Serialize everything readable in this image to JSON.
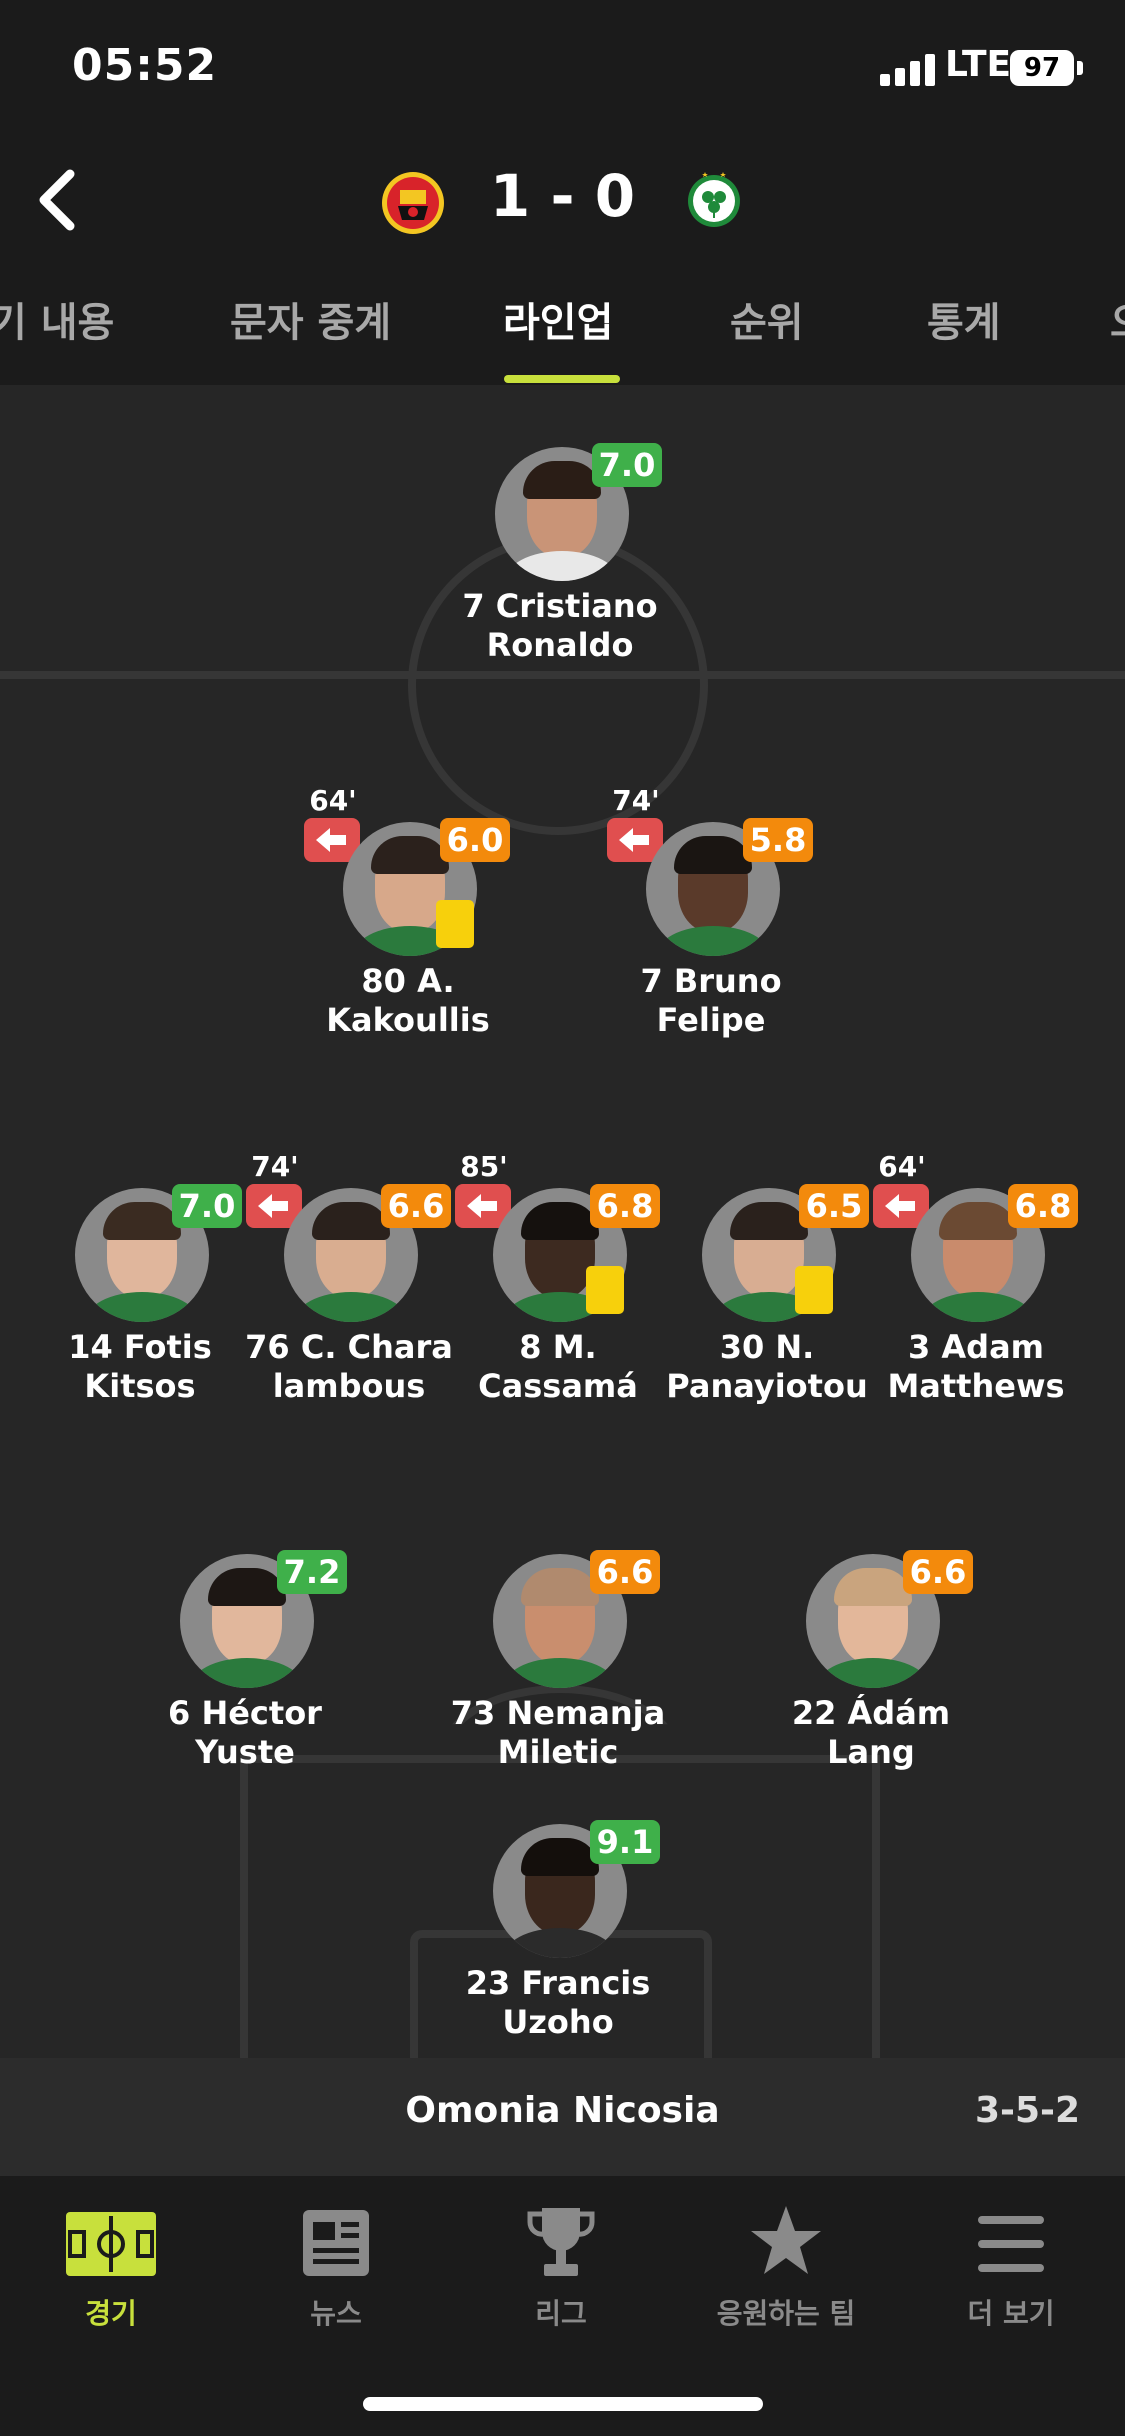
{
  "status": {
    "time": "05:52",
    "network": "LTE",
    "battery": "97"
  },
  "header": {
    "score": "1 - 0",
    "home_logo_icon": "manchester-united-crest-icon",
    "away_logo_icon": "omonia-crest-icon"
  },
  "tabs": [
    {
      "label": "기 내용"
    },
    {
      "label": "문자 중계"
    },
    {
      "label": "라인업",
      "active": true
    },
    {
      "label": "순위"
    },
    {
      "label": "통계"
    },
    {
      "label": "오"
    }
  ],
  "players": {
    "gk": {
      "name_line1": "23 Francis Uzoho",
      "name_line2": "",
      "rating": "9.1"
    },
    "df1": {
      "name_line1": "6 Héctor",
      "name_line2": "Yuste",
      "rating": "7.2"
    },
    "df2": {
      "name_line1": "73 Nemanja",
      "name_line2": "Miletic",
      "rating": "6.6"
    },
    "df3": {
      "name_line1": "22 Ádám",
      "name_line2": "Lang",
      "rating": "6.6"
    },
    "mf1": {
      "name_line1": "14 Fotis",
      "name_line2": "Kitsos",
      "rating": "7.0"
    },
    "mf2": {
      "name_line1": "76 C. Chara",
      "name_line2": "lambous",
      "rating": "6.6",
      "sub_time": "74'"
    },
    "mf3": {
      "name_line1": "8 M.",
      "name_line2": "Cassamá",
      "rating": "6.8",
      "sub_time": "85'"
    },
    "mf4": {
      "name_line1": "30 N.",
      "name_line2": "Panayiotou",
      "rating": "6.5"
    },
    "mf5": {
      "name_line1": "3 Adam",
      "name_line2": "Matthews",
      "rating": "6.8",
      "sub_time": "64'"
    },
    "fw1": {
      "name_line1": "80 A.",
      "name_line2": "Kakoullis",
      "rating": "6.0",
      "sub_time": "64'"
    },
    "fw2": {
      "name_line1": "7 Bruno",
      "name_line2": "Felipe",
      "rating": "5.8",
      "sub_time": "74'"
    },
    "opp": {
      "name_line1": "7 Cristiano Ronaldo",
      "name_line2": "",
      "rating": "7.0"
    }
  },
  "team": {
    "name": "Omonia Nicosia",
    "formation": "3-5-2"
  },
  "nav": [
    {
      "label": "경기",
      "icon": "pitch-icon",
      "active": true
    },
    {
      "label": "뉴스",
      "icon": "news-icon"
    },
    {
      "label": "리그",
      "icon": "trophy-icon"
    },
    {
      "label": "응원하는 팀",
      "icon": "star-icon"
    },
    {
      "label": "더 보기",
      "icon": "menu-icon"
    }
  ],
  "colors": {
    "accent": "#c8e03c",
    "rating_green": "#3fb04a",
    "rating_orange": "#f38a0c",
    "sub_red": "#e04f4f",
    "yellow_card": "#f7d00c"
  }
}
